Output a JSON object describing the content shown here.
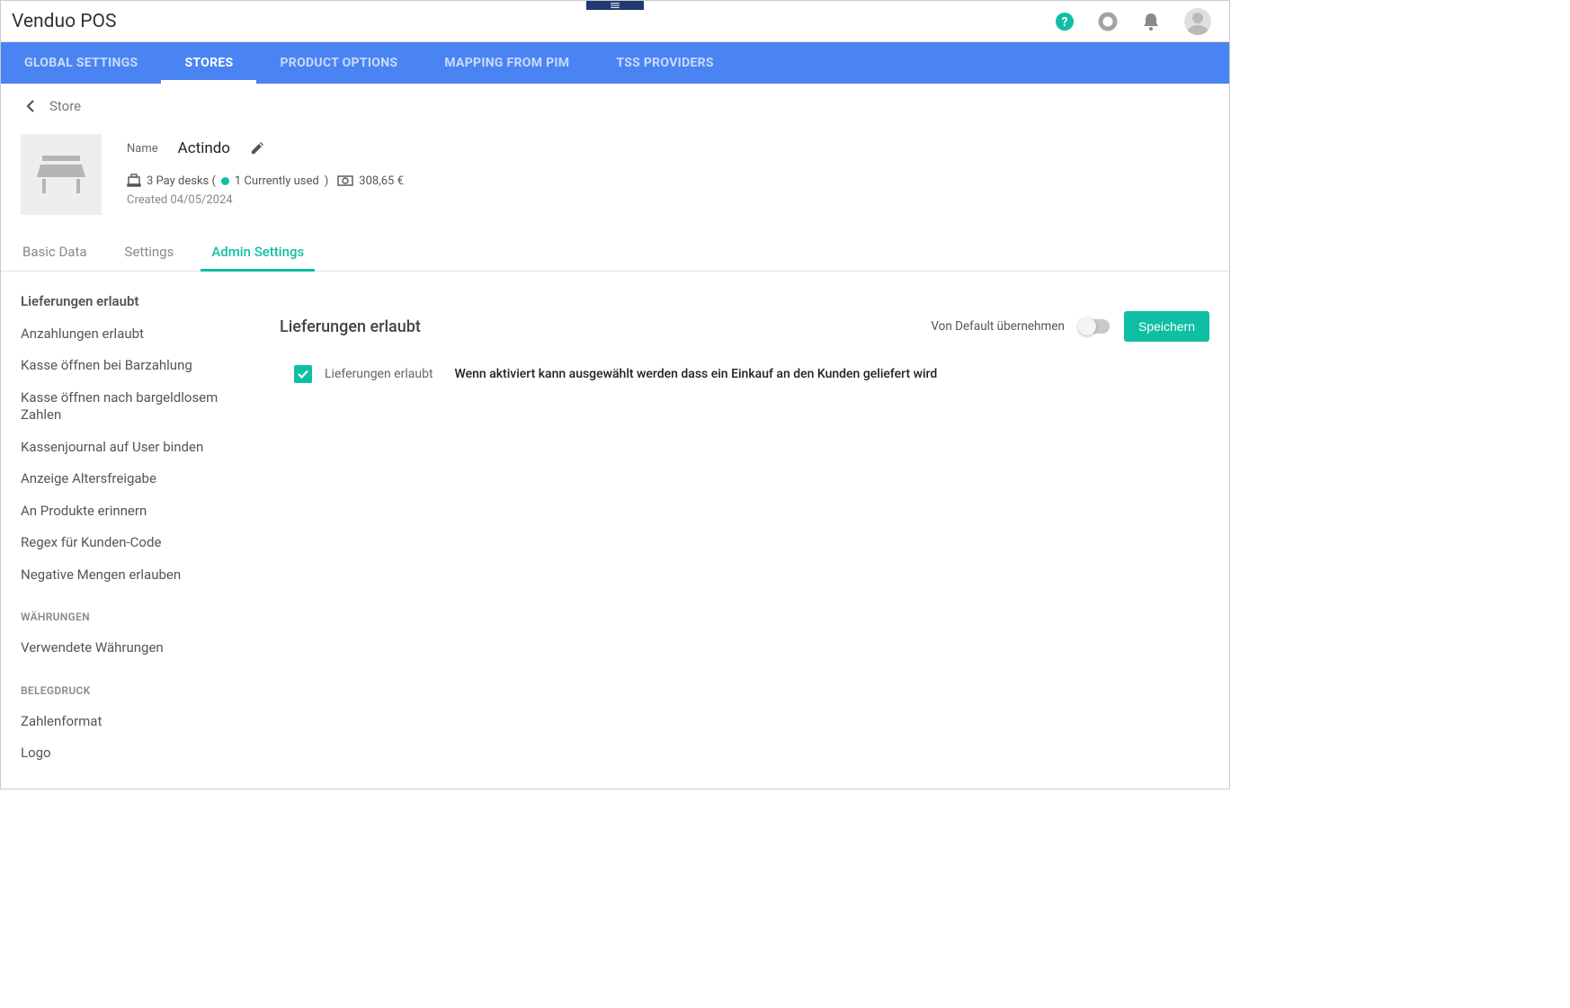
{
  "app_title": "Venduo POS",
  "nav": {
    "tabs": [
      {
        "label": "GLOBAL SETTINGS",
        "active": false
      },
      {
        "label": "STORES",
        "active": true
      },
      {
        "label": "PRODUCT OPTIONS",
        "active": false
      },
      {
        "label": "MAPPING FROM PIM",
        "active": false
      },
      {
        "label": "TSS PROVIDERS",
        "active": false
      }
    ]
  },
  "breadcrumb": {
    "label": "Store"
  },
  "store": {
    "name_label": "Name",
    "name": "Actindo",
    "paydesks_prefix": "3 Pay desks (",
    "paydesks_used": "1 Currently used",
    "paydesks_suffix": ")",
    "amount": "308,65 €",
    "created": "Created 04/05/2024"
  },
  "subtabs": [
    {
      "label": "Basic Data",
      "active": false
    },
    {
      "label": "Settings",
      "active": false
    },
    {
      "label": "Admin Settings",
      "active": true
    }
  ],
  "side": {
    "group1_items": [
      "Lieferungen erlaubt",
      "Anzahlungen erlaubt",
      "Kasse öffnen bei Barzahlung",
      "Kasse öffnen nach bargeldlosem Zahlen",
      "Kassenjournal auf User binden",
      "Anzeige Altersfreigabe",
      "An Produkte erinnern",
      "Regex für Kunden-Code",
      "Negative Mengen erlauben"
    ],
    "group2_title": "WÄHRUNGEN",
    "group2_items": [
      "Verwendete Währungen"
    ],
    "group3_title": "BELEGDRUCK",
    "group3_items": [
      "Zahlenformat",
      "Logo"
    ]
  },
  "detail": {
    "title": "Lieferungen erlaubt",
    "default_label": "Von Default übernehmen",
    "save_label": "Speichern",
    "setting_label": "Lieferungen erlaubt",
    "setting_desc": "Wenn aktiviert kann ausgewählt werden dass ein Einkauf an den Kunden geliefert wird"
  }
}
